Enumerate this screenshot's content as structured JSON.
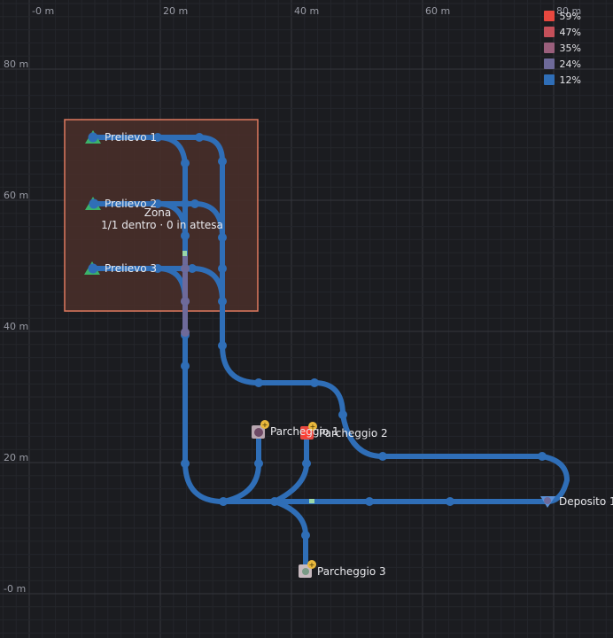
{
  "map": {
    "x_ticks": [
      "-0 m",
      "20 m",
      "40 m",
      "60 m",
      "80 m"
    ],
    "y_ticks": [
      "80 m",
      "60 m",
      "40 m",
      "20 m",
      "-0 m"
    ],
    "colors": {
      "background": "#1b1c20",
      "grid_minor": "#25272c",
      "grid_major": "#33353c",
      "track": "#2f6eb7",
      "zone_fill": "#4a2f2a",
      "zone_border": "#e07a5f",
      "source": "#3bb36a"
    }
  },
  "zone": {
    "name": "Zona",
    "status": "1/1 dentro · 0 in attesa"
  },
  "sources": [
    {
      "label": "Prelievo 1"
    },
    {
      "label": "Prelievo 2"
    },
    {
      "label": "Prelievo 3"
    }
  ],
  "parkings": [
    {
      "label": "Parcheggio 1"
    },
    {
      "label": "Parcheggio 2"
    },
    {
      "label": "Parcheggio 3"
    }
  ],
  "deposit": {
    "label": "Deposito 1"
  },
  "legend": [
    {
      "label": "59%",
      "color": "#e8483f"
    },
    {
      "label": "47%",
      "color": "#c4505a"
    },
    {
      "label": "35%",
      "color": "#9a5f7c"
    },
    {
      "label": "24%",
      "color": "#6e6a9a"
    },
    {
      "label": "12%",
      "color": "#2f6eb7"
    }
  ]
}
